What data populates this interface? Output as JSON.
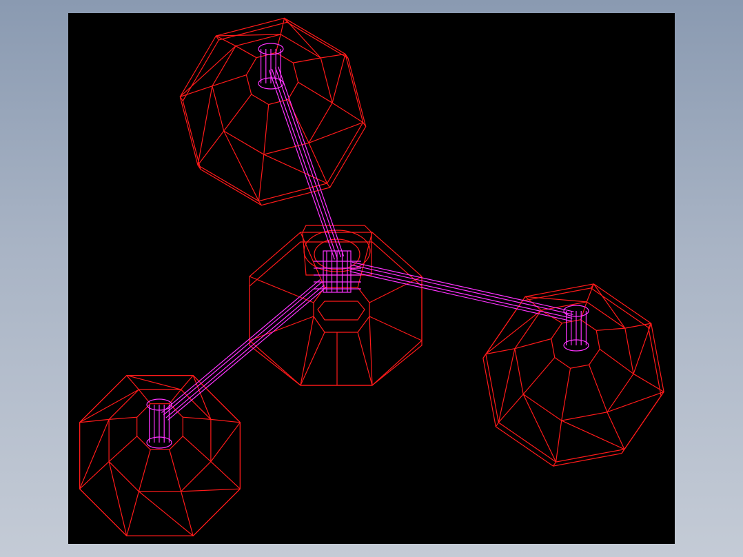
{
  "colors": {
    "background_top": "#8a9ab1",
    "background_bottom": "#c4cbd6",
    "viewport": "#000000",
    "edges": "#ff1a1a",
    "pipes": "#ff33ff"
  },
  "scene": {
    "view_mode": "wireframe",
    "parts": [
      "base-hub",
      "foot-top-left",
      "foot-right",
      "foot-bottom-left",
      "pipe-top-left",
      "pipe-right",
      "pipe-bottom-left"
    ]
  }
}
